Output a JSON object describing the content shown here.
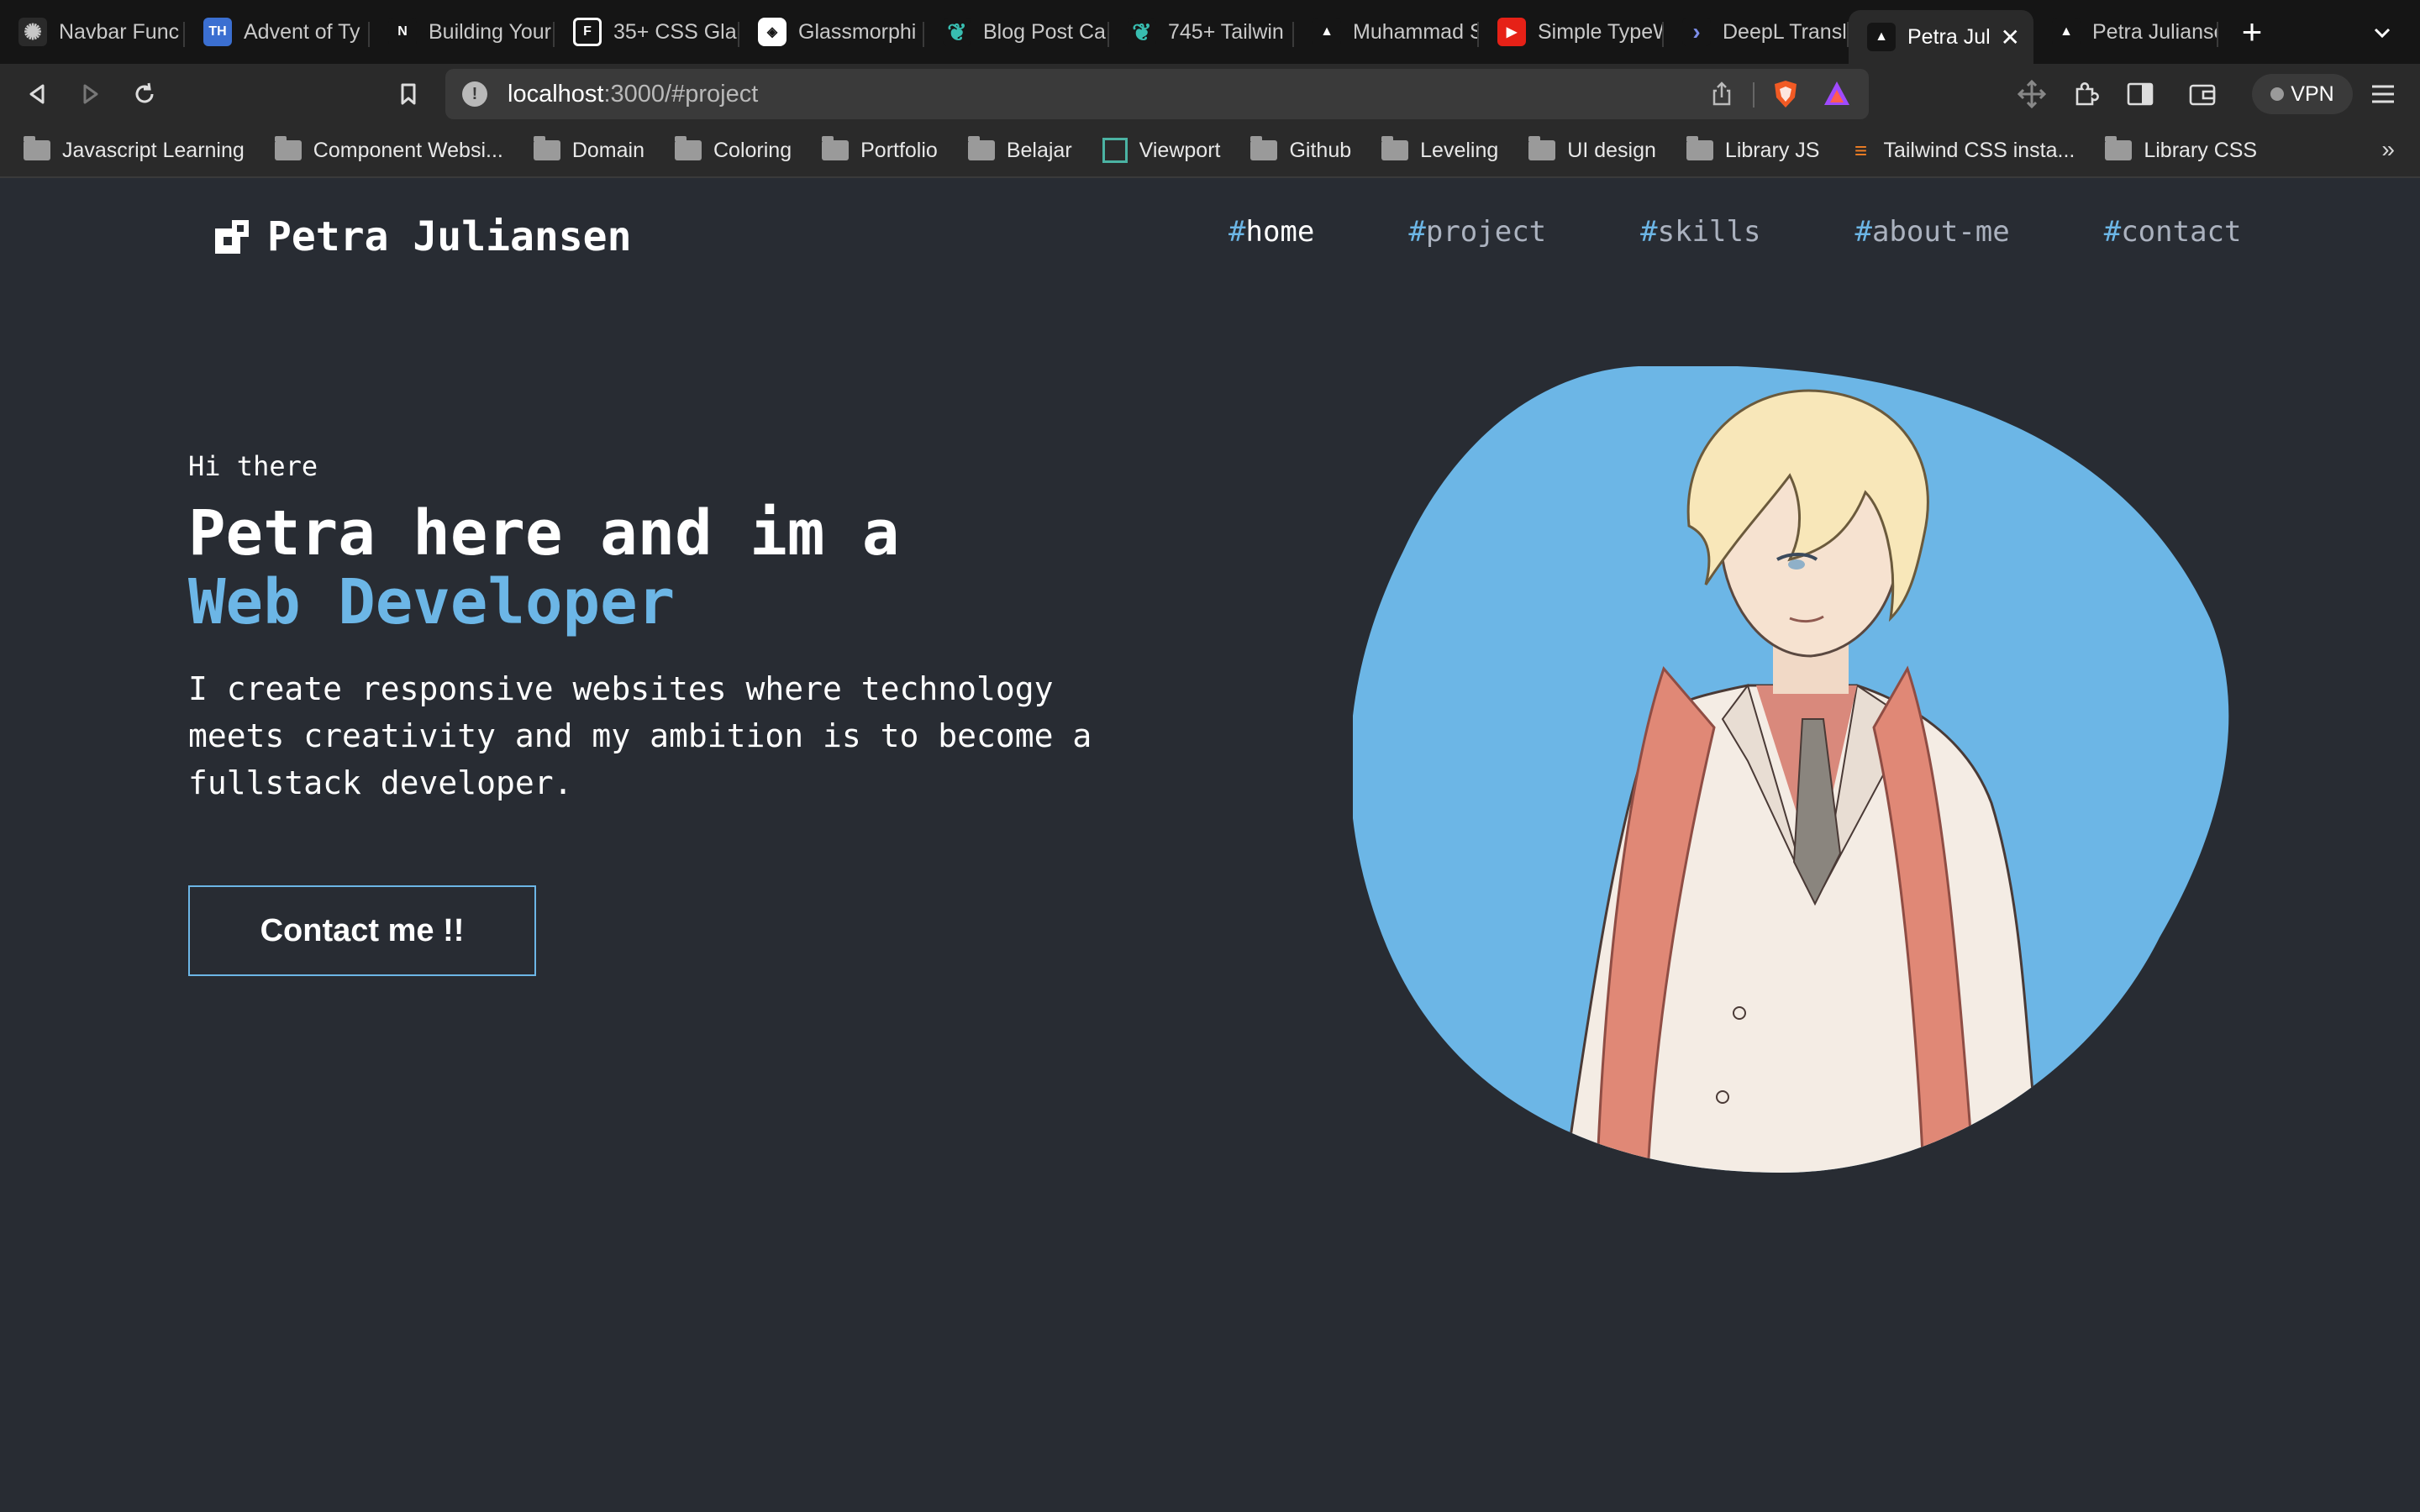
{
  "browser": {
    "tabs": [
      {
        "label": "Navbar Func",
        "icon": "chatgpt-icon",
        "color": "#2a2a2a"
      },
      {
        "label": "Advent of Ty",
        "icon": "typehero-icon",
        "color": "#3b6fd1"
      },
      {
        "label": "Building Your",
        "icon": "notion-icon",
        "color": "#151515"
      },
      {
        "label": "35+ CSS Gla",
        "icon": "freefrontend-icon",
        "color": "#151515"
      },
      {
        "label": "Glassmorphi",
        "icon": "glass-icon",
        "color": "#151515"
      },
      {
        "label": "Blog Post Ca",
        "icon": "leaf-icon",
        "color": "#151515"
      },
      {
        "label": "745+ Tailwin",
        "icon": "leaf-icon",
        "color": "#151515"
      },
      {
        "label": "Muhammad S",
        "icon": "vercel-icon",
        "color": "#151515"
      },
      {
        "label": "Simple TypeW",
        "icon": "youtube-icon",
        "color": "#e62117"
      },
      {
        "label": "DeepL Transl",
        "icon": "deepl-icon",
        "color": "#151515"
      },
      {
        "label": "Petra Juliansen",
        "icon": "vercel-icon",
        "color": "#151515",
        "active": true
      },
      {
        "label": "Petra Juliansen",
        "icon": "vercel-icon",
        "color": "#151515"
      }
    ],
    "url_host": "localhost",
    "url_path": ":3000/#project",
    "vpn_label": "VPN",
    "bookmarks": [
      {
        "label": "Javascript Learning",
        "type": "folder"
      },
      {
        "label": "Component Websi...",
        "type": "folder"
      },
      {
        "label": "Domain",
        "type": "folder"
      },
      {
        "label": "Coloring",
        "type": "folder"
      },
      {
        "label": "Portfolio",
        "type": "folder"
      },
      {
        "label": "Belajar",
        "type": "folder"
      },
      {
        "label": "Viewport",
        "type": "viewport"
      },
      {
        "label": "Github",
        "type": "folder"
      },
      {
        "label": "Leveling",
        "type": "folder"
      },
      {
        "label": "UI design",
        "type": "folder"
      },
      {
        "label": "Library JS",
        "type": "folder"
      },
      {
        "label": "Tailwind CSS insta...",
        "type": "stackoverflow"
      },
      {
        "label": "Library CSS",
        "type": "folder"
      }
    ],
    "bookmarks_more": "»"
  },
  "site": {
    "brand": "Petra Juliansen",
    "nav": [
      {
        "hash": "#",
        "label": "home",
        "active": true
      },
      {
        "hash": "#",
        "label": "project",
        "active": false
      },
      {
        "hash": "#",
        "label": "skills",
        "active": false
      },
      {
        "hash": "#",
        "label": "about-me",
        "active": false
      },
      {
        "hash": "#",
        "label": "contact",
        "active": false
      }
    ],
    "hero": {
      "greeting": "Hi there",
      "headline": "Petra here and im a",
      "role": "Web Developer",
      "description": "I create responsive websites where technology meets creativity and my ambition is to become a fullstack developer.",
      "cta": "Contact me !!"
    },
    "colors": {
      "background": "#282c33",
      "accent": "#6cb6e6",
      "blob": "#6cb6e6"
    }
  }
}
